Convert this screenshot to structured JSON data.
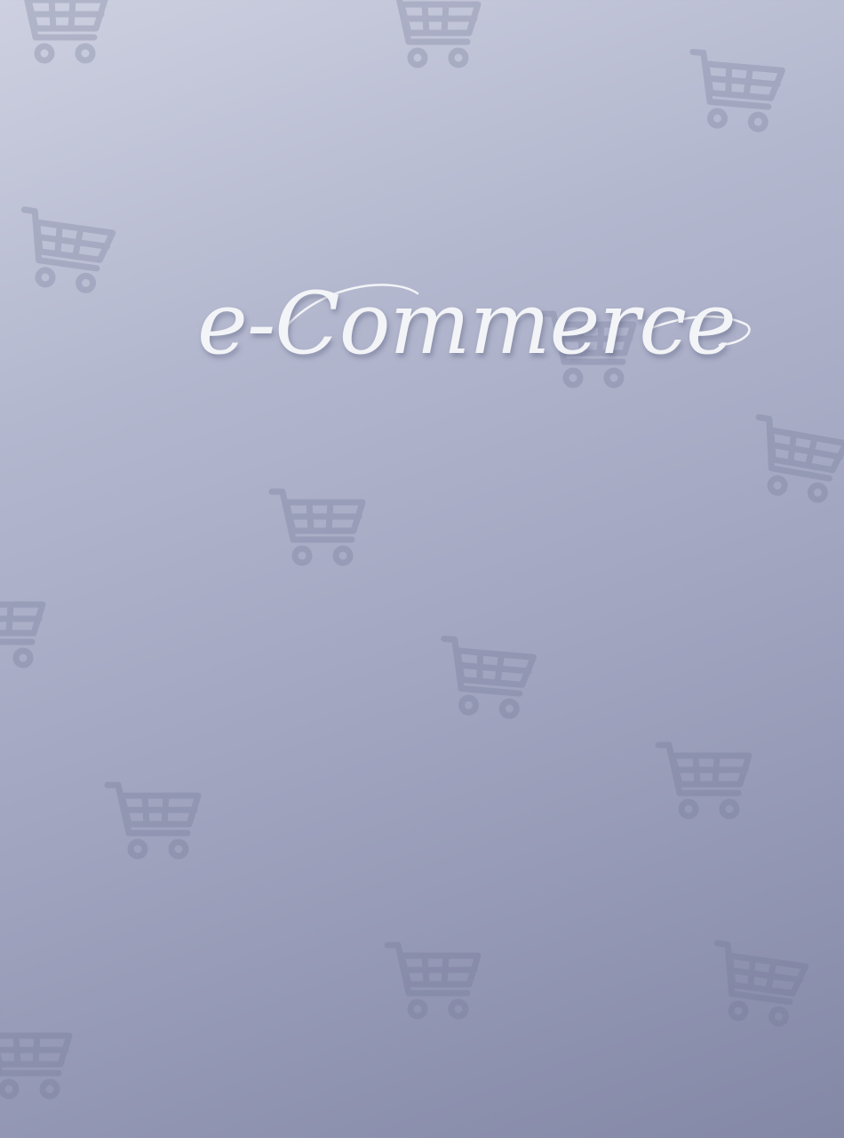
{
  "page": {
    "heading": "e-Commerce"
  },
  "background": {
    "pattern_icon": "shopping-cart-icon",
    "colors": {
      "gradient_start": "#cdd0e0",
      "gradient_end": "#8388a6",
      "icon_tint": "#6e7392",
      "heading_color": "#f3f4f7"
    }
  }
}
